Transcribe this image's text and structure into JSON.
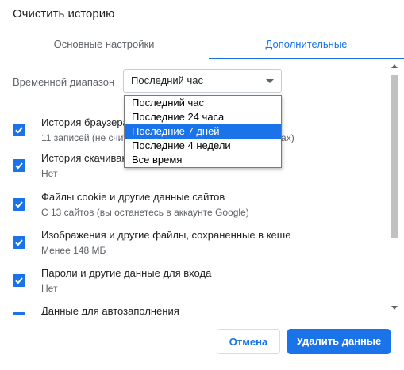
{
  "dialog": {
    "title": "Очистить историю"
  },
  "tabs": [
    {
      "label": "Основные настройки",
      "active": false
    },
    {
      "label": "Дополнительные",
      "active": true
    }
  ],
  "time_range": {
    "label": "Временной диапазон",
    "selected": "Последний час",
    "options": [
      "Последний час",
      "Последние 24 часа",
      "Последние 7 дней",
      "Последние 4 недели",
      "Все время"
    ],
    "highlighted": "Последние 7 дней"
  },
  "items": [
    {
      "title": "История браузера",
      "subtitle": "11 записей (не считая синхронизированных устройствах)",
      "checked": true
    },
    {
      "title": "История скачиваний",
      "subtitle": "Нет",
      "checked": true
    },
    {
      "title": "Файлы cookie и другие данные сайтов",
      "subtitle": "С 13 сайтов (вы останетесь в аккаунте Google)",
      "checked": true
    },
    {
      "title": "Изображения и другие файлы, сохраненные в кеше",
      "subtitle": "Менее 148 МБ",
      "checked": true
    },
    {
      "title": "Пароли и другие данные для входа",
      "subtitle": "Нет",
      "checked": true
    },
    {
      "title": "Данные для автозаполнения",
      "subtitle": "",
      "checked": true
    }
  ],
  "buttons": {
    "cancel": "Отмена",
    "delete": "Удалить данные"
  },
  "colors": {
    "accent": "#1a73e8",
    "text": "#202124",
    "secondary": "#5f6368",
    "divider": "#dadce0"
  }
}
